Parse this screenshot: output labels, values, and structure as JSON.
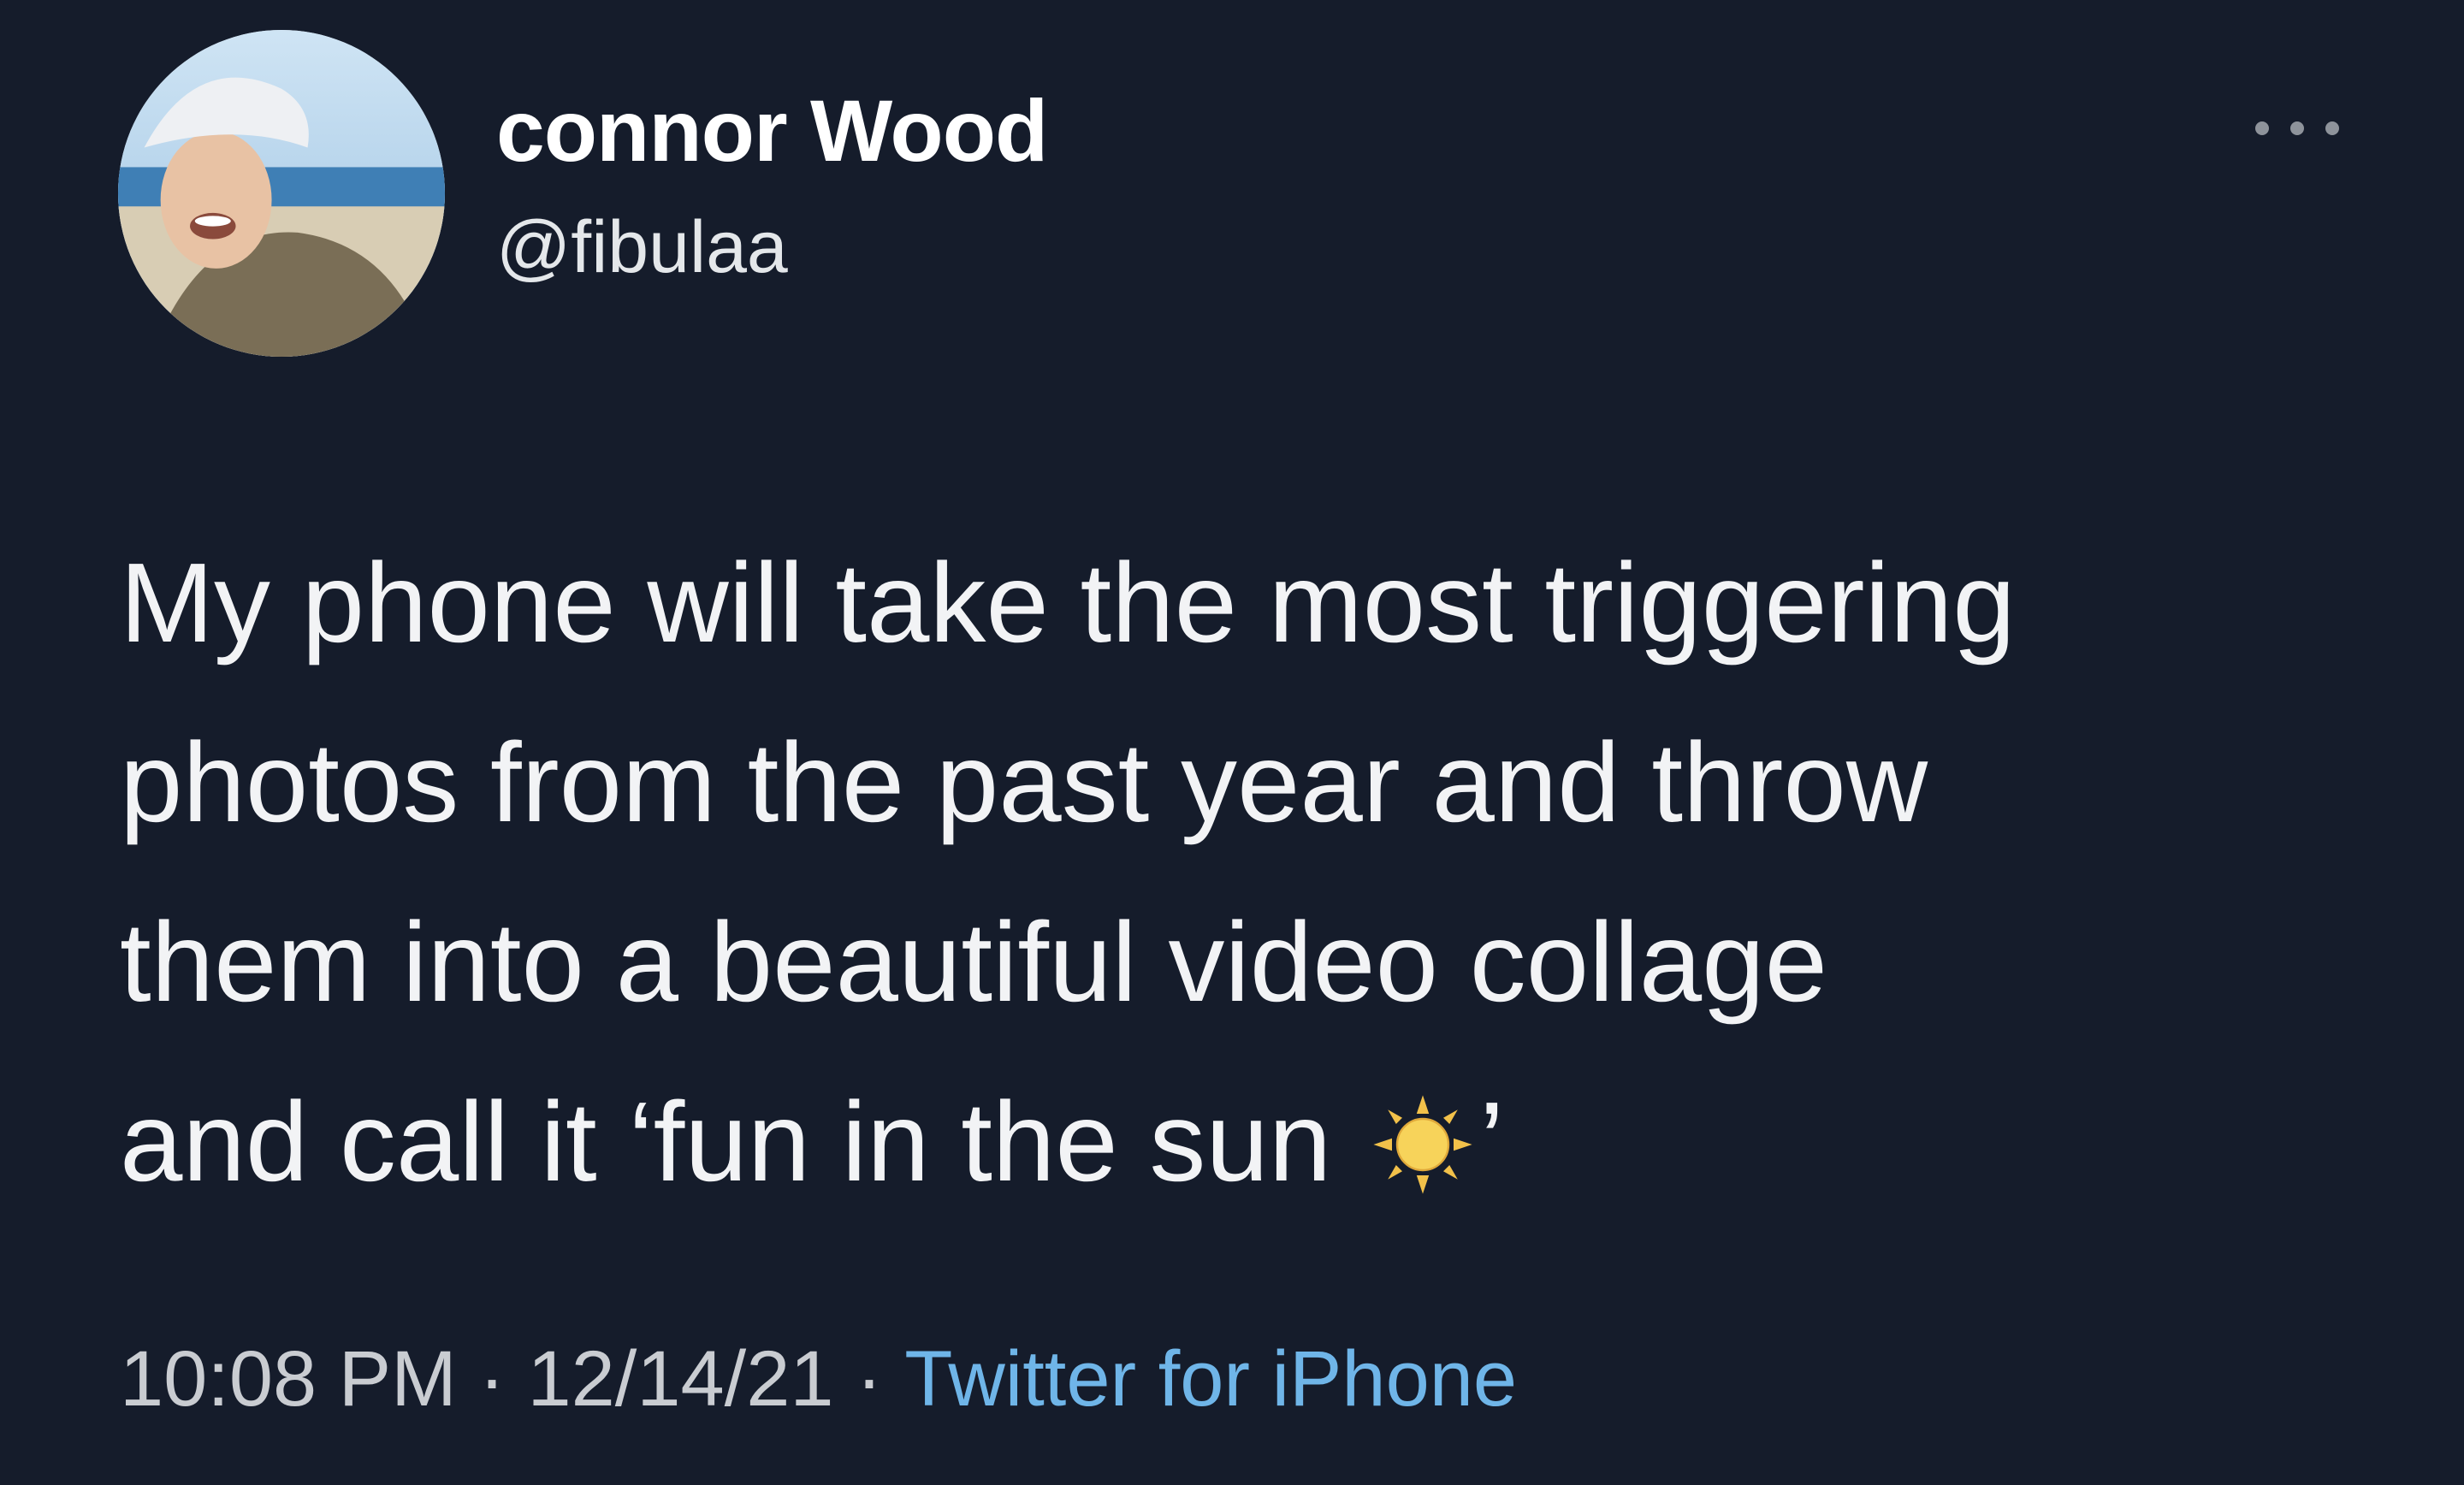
{
  "tweet": {
    "display_name": "connor Wood",
    "handle": "@fibulaa",
    "more_icon": "ellipsis-icon",
    "text_lines": [
      "My phone will take the most triggering",
      "photos from the past year and throw",
      "them into a beautiful video collage",
      "and call it ‘fun in the sun"
    ],
    "text_closing": "’",
    "emoji": "sun-icon",
    "time": "10:08 PM",
    "separator": "·",
    "date": "12/14/21",
    "source": "Twitter for iPhone"
  },
  "colors": {
    "background": "#151c2b",
    "text": "#f2f3f5",
    "link": "#6fb5e8",
    "meta": "#c9ccd1"
  }
}
